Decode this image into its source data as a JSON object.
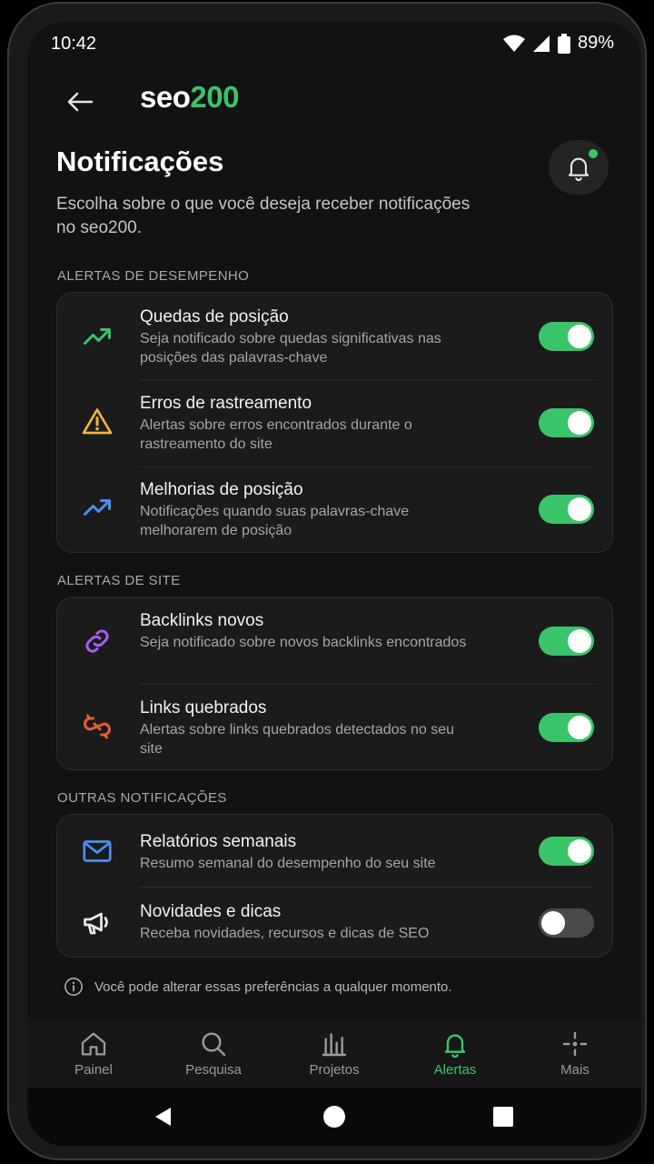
{
  "status": {
    "time": "10:42",
    "battery": "89%"
  },
  "header": {
    "logo_seo": "seo",
    "logo_200": "200"
  },
  "page": {
    "title": "Notificações",
    "subtitle": "Escolha sobre o que você deseja receber notificações no seo200."
  },
  "sections": [
    {
      "label": "ALERTAS DE DESEMPENHO",
      "items": [
        {
          "title": "Quedas de posição",
          "desc": "Seja notificado sobre quedas significativas nas posições das palavras-chave",
          "icon": "trend-up-icon",
          "color": "#3ac46a",
          "enabled": true
        },
        {
          "title": "Erros de rastreamento",
          "desc": "Alertas sobre erros encontrados durante o rastreamento do site",
          "icon": "warning-icon",
          "color": "#f0b43c",
          "enabled": true
        },
        {
          "title": "Melhorias de posição",
          "desc": "Notificações quando suas palavras-chave melhorarem de posição",
          "icon": "trend-up-icon",
          "color": "#4a8ff0",
          "enabled": true
        }
      ]
    },
    {
      "label": "ALERTAS DE SITE",
      "items": [
        {
          "title": "Backlinks novos",
          "desc": "Seja notificado sobre novos backlinks encontrados",
          "icon": "link-icon",
          "color": "#a65cf0",
          "enabled": true
        },
        {
          "title": "Links quebrados",
          "desc": "Alertas sobre links quebrados detectados no seu site",
          "icon": "broken-link-icon",
          "color": "#e85a3c",
          "enabled": true
        }
      ]
    },
    {
      "label": "OUTRAS NOTIFICAÇÕES",
      "items": [
        {
          "title": "Relatórios semanais",
          "desc": "Resumo semanal do desempenho do seu site",
          "icon": "mail-icon",
          "color": "#4a8ff0",
          "enabled": true
        },
        {
          "title": "Novidades e dicas",
          "desc": "Receba novidades, recursos e dicas de SEO",
          "icon": "megaphone-icon",
          "color": "#e8e8e8",
          "enabled": false
        }
      ]
    }
  ],
  "footnote": "Você pode alterar essas preferências a qualquer momento.",
  "nav": [
    {
      "label": "Painel",
      "icon": "home-icon",
      "active": false
    },
    {
      "label": "Pesquisa",
      "icon": "search-icon",
      "active": false
    },
    {
      "label": "Projetos",
      "icon": "bar-chart-icon",
      "active": false
    },
    {
      "label": "Alertas",
      "icon": "bell-icon",
      "active": true
    },
    {
      "label": "Mais",
      "icon": "more-icon",
      "active": false
    }
  ],
  "colors": {
    "accent": "#3ac46a",
    "background": "#121212",
    "card": "#1b1b1b"
  }
}
